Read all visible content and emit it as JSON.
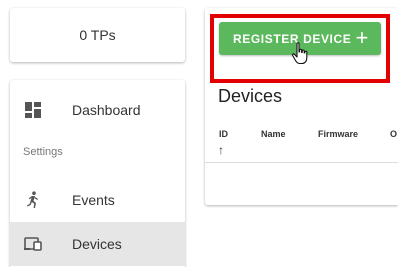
{
  "tp_counter": {
    "text": "0 TPs"
  },
  "sidebar": {
    "items": [
      {
        "label": "Dashboard",
        "icon": "dashboard-icon"
      },
      {
        "section": "Settings"
      },
      {
        "label": "Events",
        "icon": "running-person-icon"
      },
      {
        "label": "Devices",
        "icon": "devices-icon",
        "selected": true
      }
    ]
  },
  "devices_panel": {
    "register_button": {
      "label": "REGISTER DEVICE",
      "icon": "plus-icon"
    },
    "title": "Devices",
    "table": {
      "columns": [
        "ID",
        "Name",
        "Firmware",
        "O"
      ],
      "sort_indicator": "↑",
      "rows": []
    }
  },
  "colors": {
    "register_button_bg": "#5cb85c",
    "highlight_border": "#e30000",
    "selected_nav_bg": "#e6e6e6"
  }
}
